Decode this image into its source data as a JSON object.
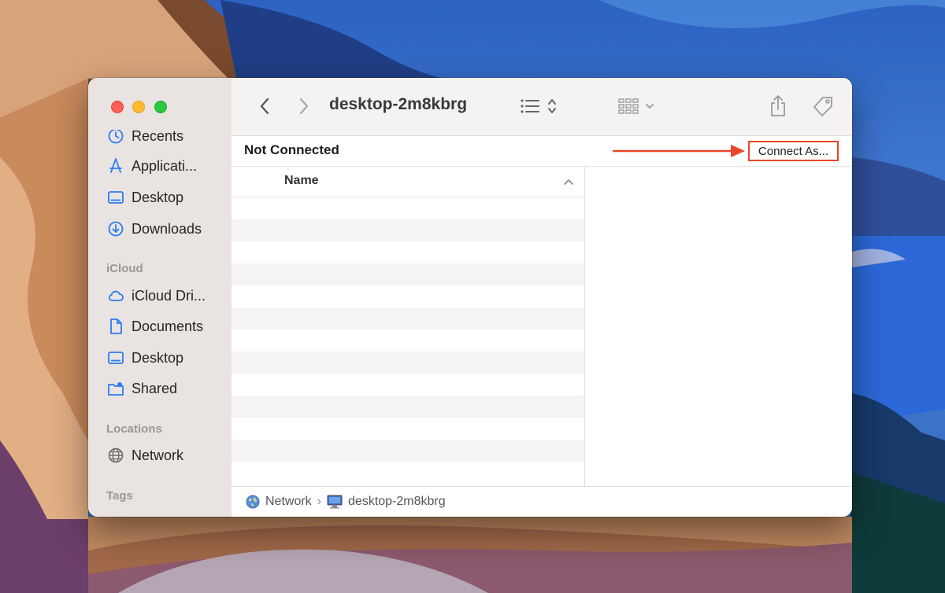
{
  "window": {
    "title": "desktop-2m8kbrg"
  },
  "sidebar": {
    "favorites": [
      {
        "label": "Recents",
        "icon": "clock-icon"
      },
      {
        "label": "Applicati...",
        "icon": "applications-icon"
      },
      {
        "label": "Desktop",
        "icon": "desktop-icon"
      },
      {
        "label": "Downloads",
        "icon": "download-icon"
      }
    ],
    "icloud_header": "iCloud",
    "icloud": [
      {
        "label": "iCloud Dri...",
        "icon": "cloud-icon"
      },
      {
        "label": "Documents",
        "icon": "document-icon"
      },
      {
        "label": "Desktop",
        "icon": "desktop-icon"
      },
      {
        "label": "Shared",
        "icon": "shared-folder-icon"
      }
    ],
    "locations_header": "Locations",
    "locations": [
      {
        "label": "Network",
        "icon": "globe-icon"
      }
    ],
    "tags_header": "Tags"
  },
  "infobar": {
    "status": "Not Connected",
    "connect_label": "Connect As..."
  },
  "list": {
    "column_name": "Name"
  },
  "pathbar": {
    "items": [
      "Network",
      "desktop-2m8kbrg"
    ],
    "separator": "›"
  },
  "colors": {
    "accent": "#2b7bf5",
    "highlight": "#e8452a",
    "sidebar_bg": "#e9e4e1"
  }
}
